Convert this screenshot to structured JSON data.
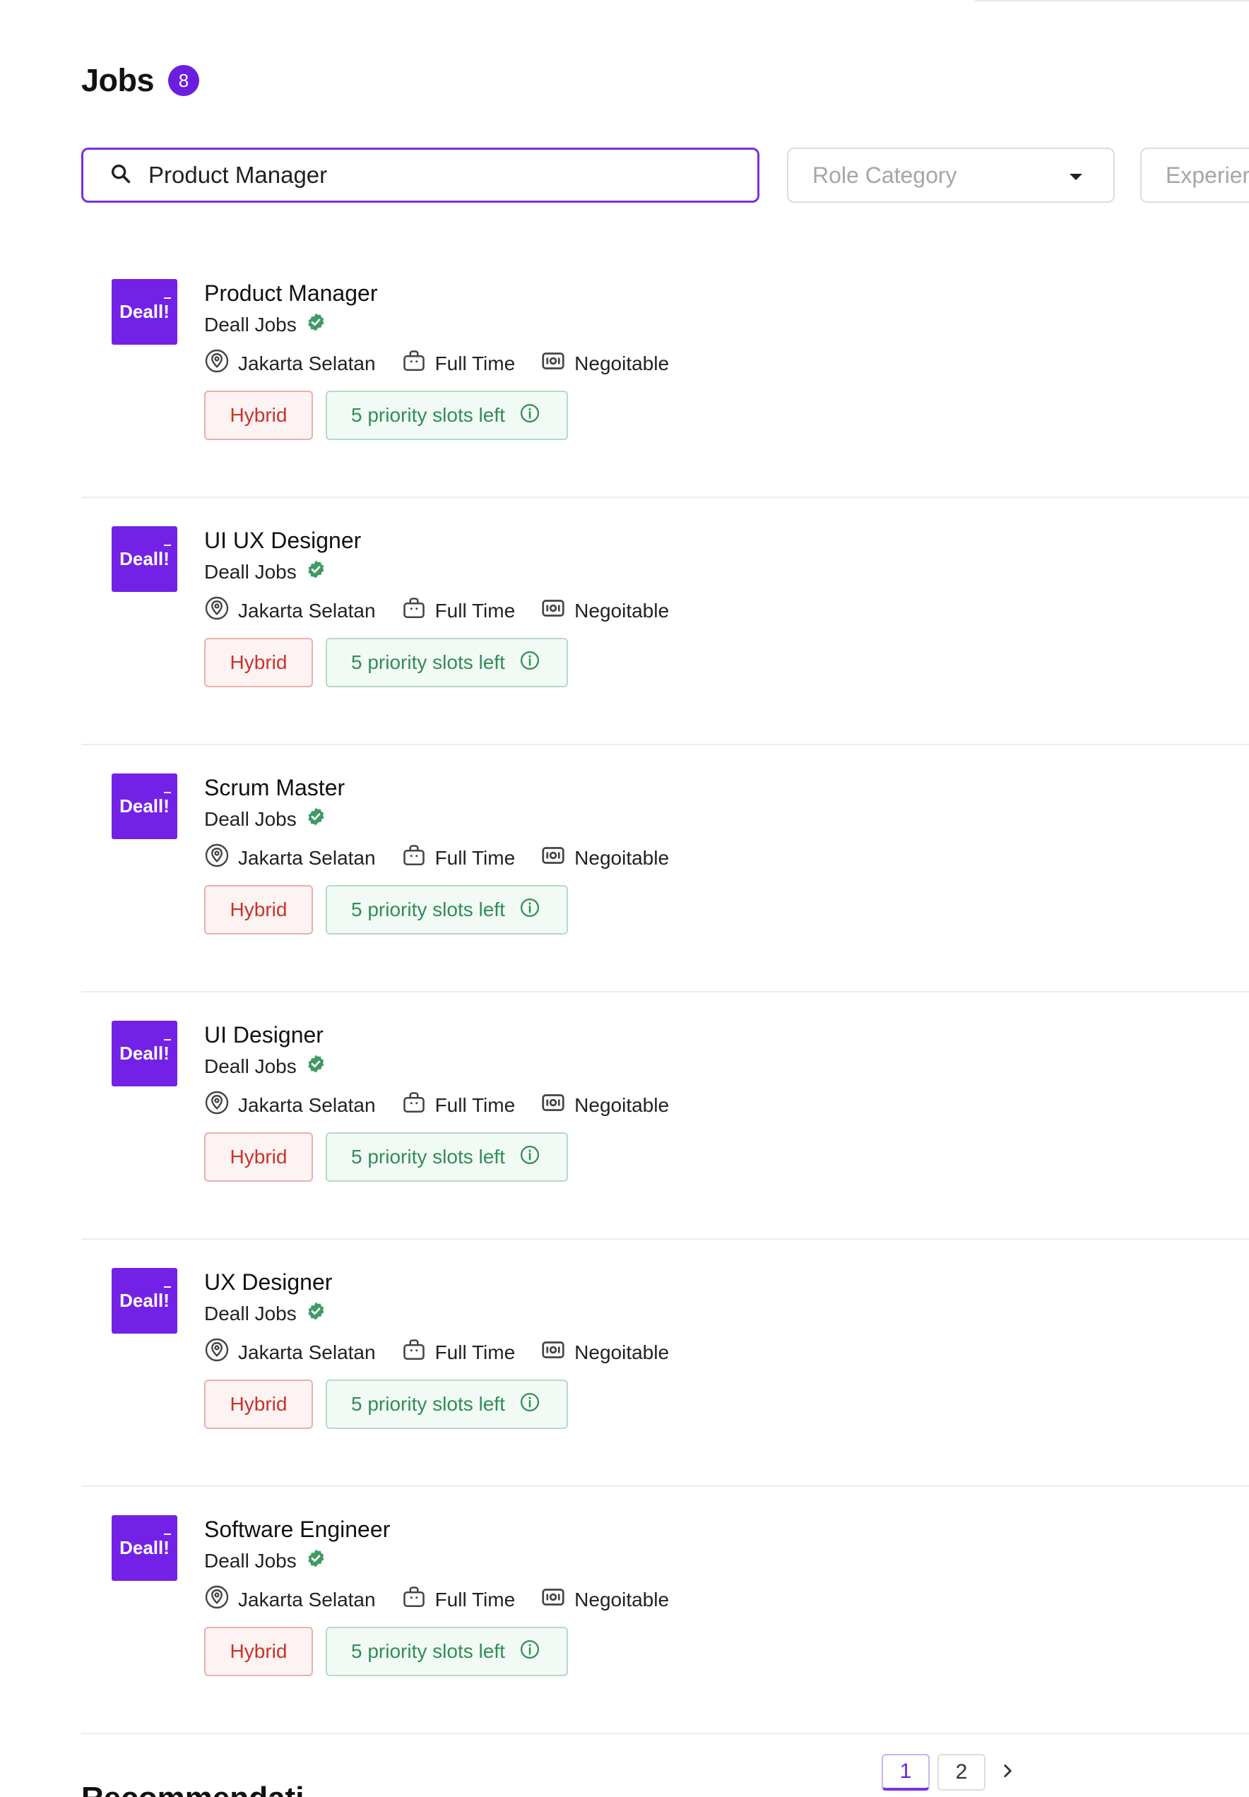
{
  "header": {
    "title": "Jobs",
    "count": "8"
  },
  "search": {
    "value": "Product Manager"
  },
  "filters": {
    "role_category": {
      "placeholder": "Role Category"
    },
    "experience": {
      "placeholder": "Experier"
    }
  },
  "colors": {
    "brand": "#6c1ee0",
    "hybrid": "#c8332a",
    "slots": "#2f8e55"
  },
  "icons": {
    "search": "search-icon",
    "dropdown": "caret-down-icon",
    "verified": "verified-badge-icon",
    "location": "location-pin-icon",
    "job_type": "briefcase-icon",
    "salary": "money-icon",
    "info": "info-icon",
    "next": "chevron-right-icon"
  },
  "jobs": [
    {
      "logo": "Deall!",
      "title": "Product Manager",
      "company": "Deall Jobs",
      "location": "Jakarta Selatan",
      "type": "Full Time",
      "salary": "Negoitable",
      "work_mode": "Hybrid",
      "slots": "5 priority slots left"
    },
    {
      "logo": "Deall!",
      "title": "UI UX Designer",
      "company": "Deall Jobs",
      "location": "Jakarta Selatan",
      "type": "Full Time",
      "salary": "Negoitable",
      "work_mode": "Hybrid",
      "slots": "5 priority slots left"
    },
    {
      "logo": "Deall!",
      "title": "Scrum Master",
      "company": "Deall Jobs",
      "location": "Jakarta Selatan",
      "type": "Full Time",
      "salary": "Negoitable",
      "work_mode": "Hybrid",
      "slots": "5 priority slots left"
    },
    {
      "logo": "Deall!",
      "title": "UI Designer",
      "company": "Deall Jobs",
      "location": "Jakarta Selatan",
      "type": "Full Time",
      "salary": "Negoitable",
      "work_mode": "Hybrid",
      "slots": "5 priority slots left"
    },
    {
      "logo": "Deall!",
      "title": "UX Designer",
      "company": "Deall Jobs",
      "location": "Jakarta Selatan",
      "type": "Full Time",
      "salary": "Negoitable",
      "work_mode": "Hybrid",
      "slots": "5 priority slots left"
    },
    {
      "logo": "Deall!",
      "title": "Software Engineer",
      "company": "Deall Jobs",
      "location": "Jakarta Selatan",
      "type": "Full Time",
      "salary": "Negoitable",
      "work_mode": "Hybrid",
      "slots": "5 priority slots left"
    }
  ],
  "pagination": {
    "pages": [
      "1",
      "2"
    ],
    "current": "1"
  },
  "next_section": {
    "heading_partial": "Recommendati"
  }
}
